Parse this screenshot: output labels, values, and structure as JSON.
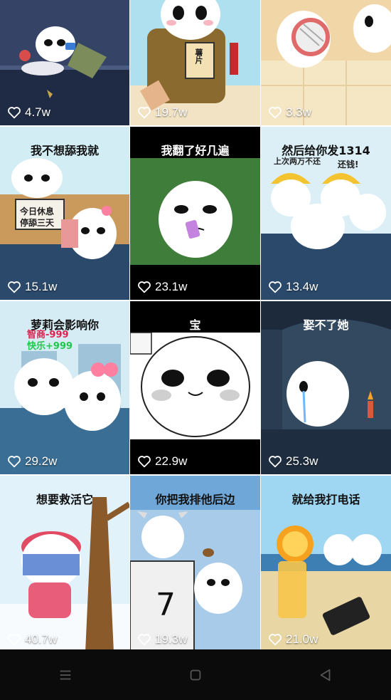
{
  "tiles": [
    {
      "likes": "4.7w",
      "caption": "",
      "bg": "#3b4a6b"
    },
    {
      "likes": "19.7w",
      "caption": "",
      "bg": "#a9d9e8",
      "sign": "薯片"
    },
    {
      "likes": "3.3w",
      "caption": "",
      "bg": "#f1d7a7"
    },
    {
      "likes": "15.1w",
      "caption": "我不想舔我就",
      "bg": "#cfe9f2",
      "sign": "今日休息 停舔三天"
    },
    {
      "likes": "23.1w",
      "caption": "我翻了好几遍",
      "bg": "#3f7a3b"
    },
    {
      "likes": "13.4w",
      "caption": "然后给你发1314",
      "bg": "#cfe9f2",
      "sub1": "上次两万不还",
      "sub2": "还钱!"
    },
    {
      "likes": "29.2w",
      "caption": "萝莉会影响你",
      "bg": "#cfe9f2",
      "sub1": "智商-999",
      "sub2": "快乐+999"
    },
    {
      "likes": "22.9w",
      "caption": "宝",
      "bg": "#ffffff"
    },
    {
      "likes": "25.3w",
      "caption": "娶不了她",
      "bg": "#2d3f55"
    },
    {
      "likes": "40.7w",
      "caption": "想要救活它",
      "bg": "#dff1fb"
    },
    {
      "likes": "19.3w",
      "caption": "你把我排他后边",
      "bg": "#6fa8d8",
      "number": "7"
    },
    {
      "likes": "21.0w",
      "caption": "就给我打电话",
      "bg": "#9fd7f2"
    }
  ],
  "colors": {
    "heart": "#ffffff",
    "navbar": "#0b0b0b"
  },
  "navbar": {
    "icons": [
      "menu-icon",
      "home-square-icon",
      "back-triangle-icon"
    ]
  }
}
